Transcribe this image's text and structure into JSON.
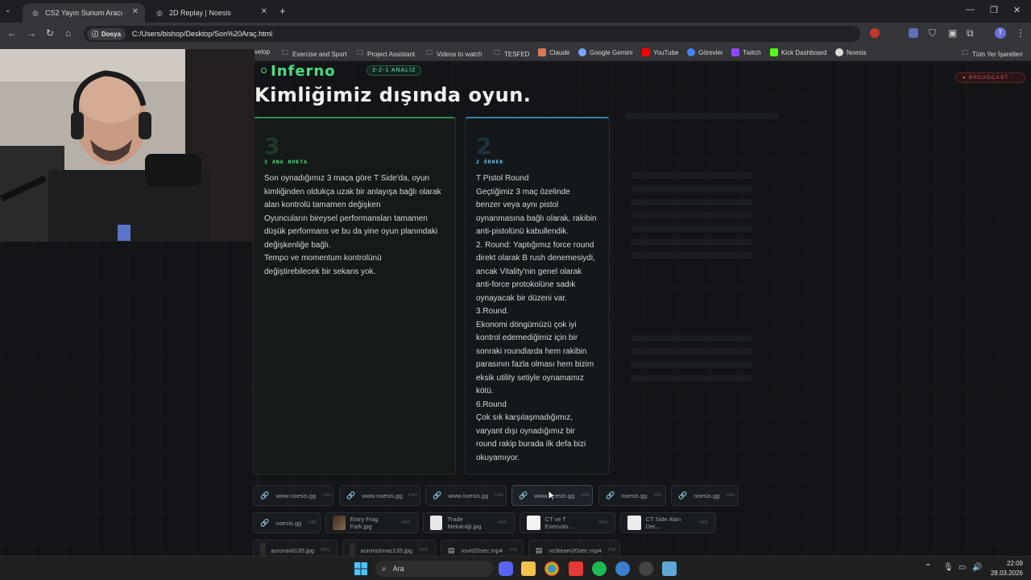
{
  "browser": {
    "tabs": [
      {
        "label": "CS2 Yayın Sunum Aracı",
        "active": true
      },
      {
        "label": "2D Replay | Noesis",
        "active": false
      }
    ],
    "new_tab": "+",
    "window_controls": {
      "minimize": "—",
      "maximize": "❐",
      "close": "✕"
    },
    "omnibox": {
      "chip": "Dosya",
      "url": "C:/Users/bishop/Desktop/Son%20Araç.html"
    },
    "bookmarks": [
      {
        "label": "velop",
        "icon": "none"
      },
      {
        "label": "Exercise and Sport",
        "icon": "folder-icon"
      },
      {
        "label": "Project Assistant",
        "icon": "folder-icon"
      },
      {
        "label": "Videos to watch",
        "icon": "folder-icon"
      },
      {
        "label": "TESFED",
        "icon": "folder-icon"
      },
      {
        "label": "Claude",
        "icon": "claude-icon"
      },
      {
        "label": "Google Gemini",
        "icon": "gemini-icon"
      },
      {
        "label": "YouTube",
        "icon": "youtube-icon"
      },
      {
        "label": "Görevler",
        "icon": "tasks-icon"
      },
      {
        "label": "Twitch",
        "icon": "twitch-icon"
      },
      {
        "label": "Kick Dashboard",
        "icon": "kick-icon"
      },
      {
        "label": "Noesis",
        "icon": "noesis-icon"
      }
    ],
    "all_bookmarks": "Tüm Yer İşaretleri"
  },
  "page": {
    "map_name": "Inferno",
    "analysis_badge": "3-2-1 ANALİZ",
    "headline": "Kimliğimiz dışında oyun.",
    "broadcast_badge": "● BROADCAST · ·",
    "card1": {
      "number": "3",
      "tag": "3 ANA NOKTA",
      "lines": [
        "Son oynadığımız 3 maça göre T Side'da, oyun",
        "kimliğinden oldukça uzak bir anlayışa bağlı olarak",
        "alan kontrolü tamamen değişken",
        "Oyuncuların bireysel performansları tamamen",
        "düşük performans ve bu da yine oyun planındaki",
        "değişkenliğe bağlı.",
        "Tempo ve momentum kontrolünü",
        "değiştirebilecek bir sekans yok."
      ]
    },
    "card2": {
      "number": "2",
      "tag": "2 ÖRNEK",
      "lines": [
        "T Pistol Round",
        "Geçtiğimiz 3 maç özelinde",
        "benzer veya aynı pistol",
        "oynanmasına bağlı olarak, rakibin",
        "anti-pistolünü kabullendik.",
        "2. Round: Yaptığımız force round",
        "direkt olarak B rush denemesiydi,",
        "ancak Vitality'nin genel olarak",
        "anti-force protokolüne sadık",
        "oynayacak bir düzeni var.",
        "3.Round.",
        "Ekonomi döngümüzü çok iyi",
        "kontrol edemediğimiz için bir",
        "sonraki roundlarda hem rakibin",
        "parasının fazla olması hem bizim",
        "eksik utility setiyle oynamamız",
        "kötü.",
        "6.Round",
        "Çok sık karşılaşmadığımız,",
        "varyant dışı oynadığımız bir",
        "round rakip burada ilk defa bizi",
        "okuyamıyor."
      ]
    },
    "links_row1": [
      {
        "label": "www.noesis.gg",
        "tag": "URL"
      },
      {
        "label": "www.noesis.gg",
        "tag": "URL"
      },
      {
        "label": "www.noesis.gg",
        "tag": "URL"
      },
      {
        "label": "www.noesis.gg",
        "tag": "URL"
      },
      {
        "label": "noesis.gg",
        "tag": "URL"
      },
      {
        "label": "noesis.gg",
        "tag": "URL"
      }
    ],
    "links_row2": [
      {
        "label": "noesis.gg",
        "tag": "URL",
        "kind": "link"
      },
      {
        "label": "Entry Frag Fark.jpg",
        "tag": "IMG",
        "kind": "img"
      },
      {
        "label": "Trade Mekaniği.jpg",
        "tag": "IMG",
        "kind": "img"
      },
      {
        "label": "CT ve T Executio...",
        "tag": "IMG",
        "kind": "img"
      },
      {
        "label": "CT Side Alan Det...",
        "tag": "IMG",
        "kind": "img"
      }
    ],
    "links_row3": [
      {
        "label": "auroravit135.jpg",
        "tag": "IMG"
      },
      {
        "label": "aurora3mac135.jpg",
        "tag": "IMG"
      },
      {
        "label": "vsvit20sec.mp4",
        "tag": "VID"
      },
      {
        "label": "vs3team20sec.mp4",
        "tag": "VID"
      }
    ]
  },
  "taskbar": {
    "search_placeholder": "Ara",
    "time": "22:09",
    "date": "28.03.2026"
  },
  "colors": {
    "accent_green": "#4ade80",
    "accent_blue": "#3b7fa0",
    "broadcast_red": "#e05a5a",
    "page_bg": "#121417"
  }
}
